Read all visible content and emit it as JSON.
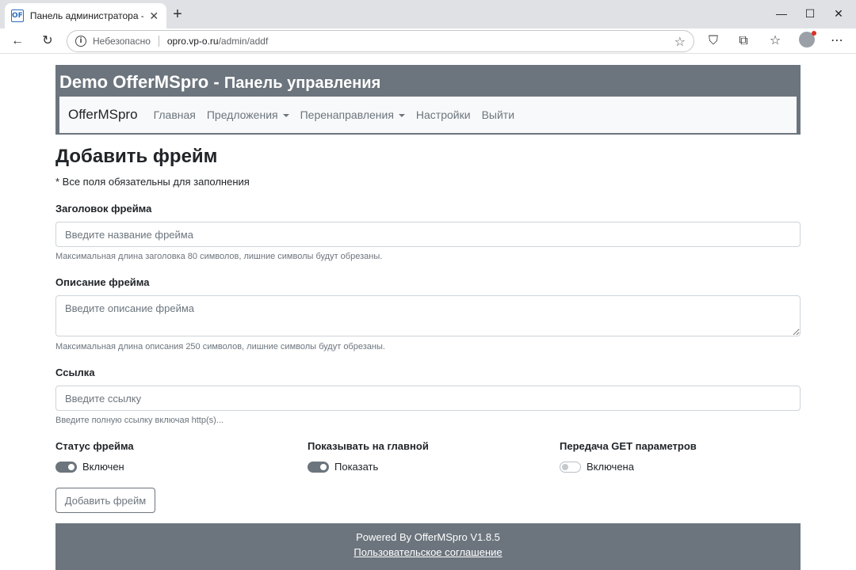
{
  "browser": {
    "tab_title": "Панель администратора - Добавить фрейм",
    "favicon_text": "OF",
    "security_label": "Небезопасно",
    "url_host": "opro.vp-o.ru",
    "url_path": "/admin/addf"
  },
  "header": {
    "site_name": "Demo OfferMSpro",
    "separator": " - ",
    "panel_title": "Панель управления"
  },
  "nav": {
    "brand": "OfferMSpro",
    "items": [
      {
        "label": "Главная",
        "dropdown": false
      },
      {
        "label": "Предложения",
        "dropdown": true
      },
      {
        "label": "Перенаправления",
        "dropdown": true
      },
      {
        "label": "Настройки",
        "dropdown": false
      },
      {
        "label": "Выйти",
        "dropdown": false
      }
    ]
  },
  "form": {
    "page_title": "Добавить фрейм",
    "required_note": "* Все поля обязательны для заполнения",
    "title_field": {
      "label": "Заголовок фрейма",
      "placeholder": "Введите название фрейма",
      "value": "",
      "hint": "Максимальная длина заголовка 80 символов, лишние символы будут обрезаны."
    },
    "description_field": {
      "label": "Описание фрейма",
      "placeholder": "Введите описание фрейма",
      "value": "",
      "hint": "Максимальная длина описания 250 символов, лишние символы будут обрезаны."
    },
    "link_field": {
      "label": "Ссылка",
      "placeholder": "Введите ссылку",
      "value": "",
      "hint": "Введите полную ссылку включая http(s)..."
    },
    "status": {
      "label": "Статус фрейма",
      "state_label": "Включен",
      "on": true
    },
    "show_main": {
      "label": "Показывать на главной",
      "state_label": "Показать",
      "on": true
    },
    "get_params": {
      "label": "Передача GET параметров",
      "state_label": "Включена",
      "on": false
    },
    "submit_label": "Добавить фрейм"
  },
  "footer": {
    "powered": "Powered By OfferMSpro V1.8.5",
    "agreement_link": "Пользовательское соглашение"
  },
  "colors": {
    "header_bg": "#6c757d",
    "navbar_bg": "#f8f9fa",
    "footer_bg": "#6c757d",
    "switch_on": "#6c757d"
  }
}
